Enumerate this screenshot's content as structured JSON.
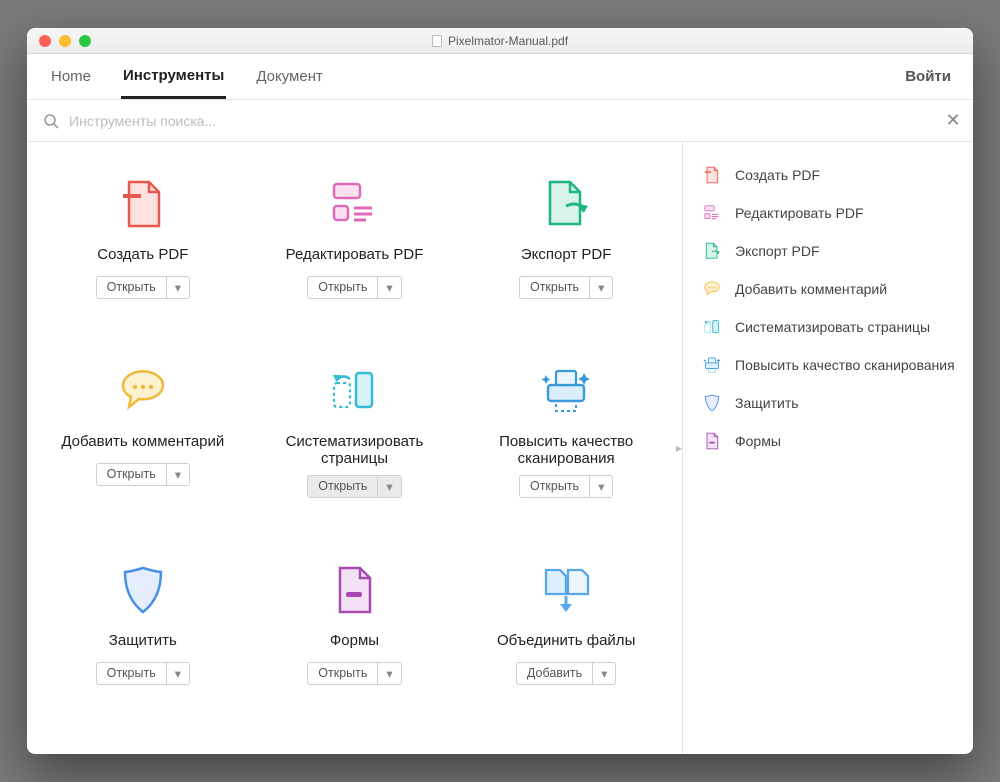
{
  "window": {
    "title": "Pixelmator-Manual.pdf"
  },
  "tabs": {
    "home": "Home",
    "tools": "Инструменты",
    "document": "Документ",
    "login": "Войти"
  },
  "search": {
    "placeholder": "Инструменты поиска..."
  },
  "button": {
    "open": "Открыть",
    "add": "Добавить"
  },
  "tools": [
    {
      "id": "create",
      "label": "Создать PDF",
      "btn": "open",
      "color": "#e8574f"
    },
    {
      "id": "edit",
      "label": "Редактировать PDF",
      "btn": "open",
      "color": "#e06ab9"
    },
    {
      "id": "export",
      "label": "Экспорт PDF",
      "btn": "open",
      "color": "#1fb57f"
    },
    {
      "id": "comment",
      "label": "Добавить комментарий",
      "btn": "open",
      "color": "#f0b93a"
    },
    {
      "id": "organize",
      "label": "Систематизировать страницы",
      "btn": "open",
      "color": "#35bcd4",
      "selected": true
    },
    {
      "id": "enhance",
      "label": "Повысить качество сканирования",
      "btn": "open",
      "color": "#3a9ad9"
    },
    {
      "id": "protect",
      "label": "Защитить",
      "btn": "open",
      "color": "#4a8fe6"
    },
    {
      "id": "forms",
      "label": "Формы",
      "btn": "open",
      "color": "#a84bb0"
    },
    {
      "id": "combine",
      "label": "Объединить файлы",
      "btn": "add",
      "color": "#5aa7e8"
    }
  ],
  "sidebar": [
    {
      "id": "create",
      "label": "Создать PDF"
    },
    {
      "id": "edit",
      "label": "Редактировать PDF"
    },
    {
      "id": "export",
      "label": "Экспорт PDF"
    },
    {
      "id": "comment",
      "label": "Добавить комментарий"
    },
    {
      "id": "organize",
      "label": "Систематизировать страницы"
    },
    {
      "id": "enhance",
      "label": "Повысить качество сканирования"
    },
    {
      "id": "protect",
      "label": "Защитить"
    },
    {
      "id": "forms",
      "label": "Формы"
    }
  ]
}
